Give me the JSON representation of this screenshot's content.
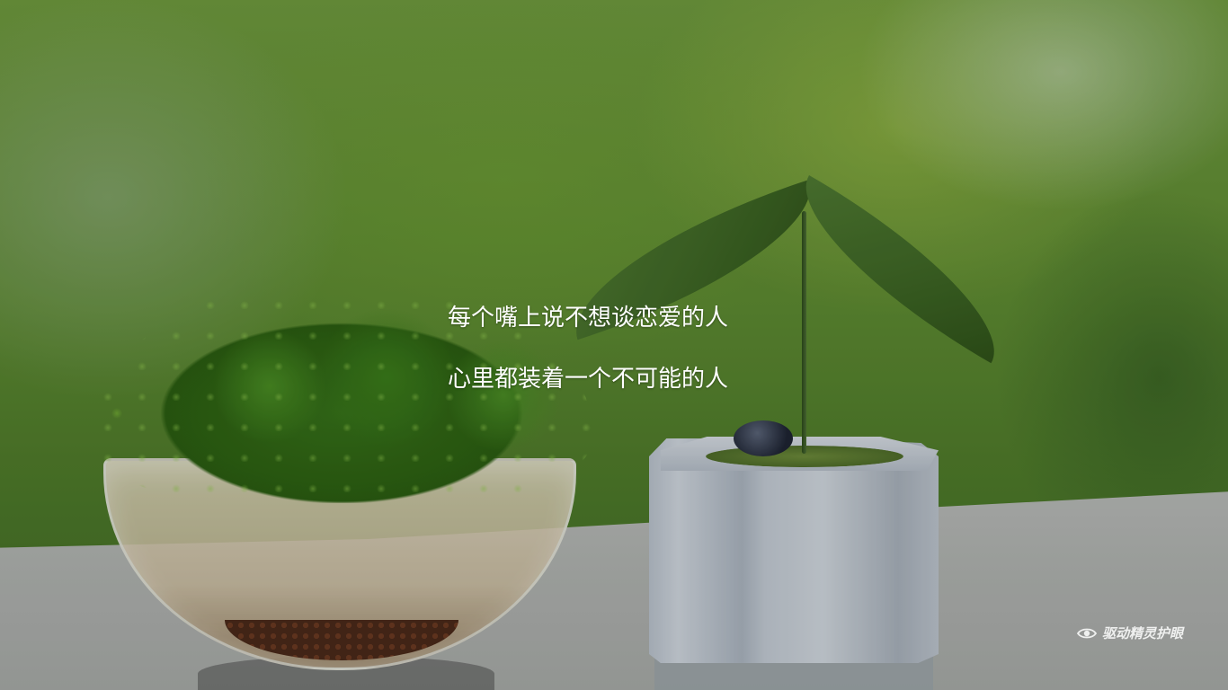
{
  "quote": {
    "line1": "每个嘴上说不想谈恋爱的人",
    "line2": "心里都装着一个不可能的人"
  },
  "watermark": {
    "icon": "eye-icon",
    "label": "驱动精灵护眼"
  }
}
